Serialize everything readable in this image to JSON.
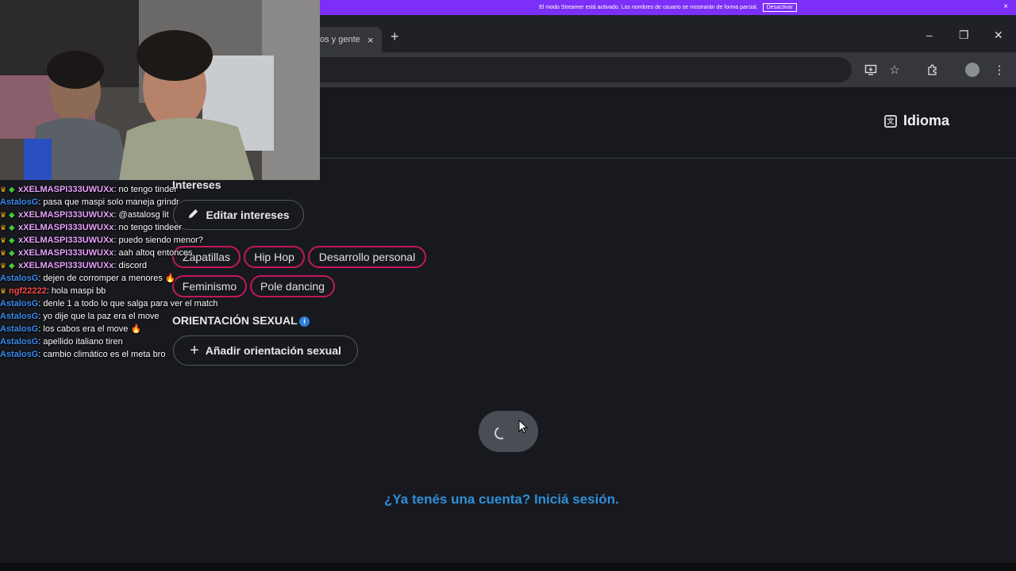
{
  "streamer_banner": {
    "text": "El modo Streamer está activado. Los nombres de usuario se mostrarán de forma parcial.",
    "button_label": "Desactivar",
    "close_icon": "×"
  },
  "browser": {
    "tab_title": "os y gente",
    "tab_close": "×",
    "new_tab": "+",
    "window_controls": {
      "minimize": "–",
      "restore": "❐",
      "close": "✕"
    },
    "toolbar_icons": [
      "install-app-icon",
      "bookmark-star-icon",
      "extensions-icon",
      "profile-avatar-icon",
      "menu-kebab-icon"
    ]
  },
  "header": {
    "language_label": "Idioma"
  },
  "interests": {
    "section_label": "Intereses",
    "edit_button_label": "Editar intereses",
    "chips": [
      "Zapatillas",
      "Hip Hop",
      "Desarrollo personal",
      "Feminismo",
      "Pole dancing"
    ]
  },
  "orientation": {
    "section_label": "ORIENTACIÓN SEXUAL",
    "add_button_label": "Añadir orientación sexual"
  },
  "login": {
    "link_text": "¿Ya tenés una cuenta? Iniciá sesión."
  },
  "chat": {
    "messages": [
      {
        "badges": [
          "crown",
          "gem"
        ],
        "user": "xXELMASPI333UWUXx",
        "user_color": "#e9a0ff",
        "text": ": no tengo tinder"
      },
      {
        "badges": [],
        "user": "AstalosG",
        "user_color": "#3a8cf0",
        "text": ": pasa que maspi solo maneja grindr"
      },
      {
        "badges": [
          "crown",
          "gem"
        ],
        "user": "xXELMASPI333UWUXx",
        "user_color": "#e9a0ff",
        "text": ": @astalosg lit"
      },
      {
        "badges": [
          "crown",
          "gem"
        ],
        "user": "xXELMASPI333UWUXx",
        "user_color": "#e9a0ff",
        "text": ": no tengo tindeer"
      },
      {
        "badges": [
          "crown",
          "gem"
        ],
        "user": "xXELMASPI333UWUXx",
        "user_color": "#e9a0ff",
        "text": ": puedo siendo menor?"
      },
      {
        "badges": [
          "crown",
          "gem"
        ],
        "user": "xXELMASPI333UWUXx",
        "user_color": "#e9a0ff",
        "text": ": aah altoq entonces"
      },
      {
        "badges": [
          "crown",
          "gem"
        ],
        "user": "xXELMASPI333UWUXx",
        "user_color": "#e9a0ff",
        "text": ": discord"
      },
      {
        "badges": [],
        "user": "AstalosG",
        "user_color": "#3a8cf0",
        "text": ": dejen de corromper a menores 🔥"
      },
      {
        "badges": [
          "crown"
        ],
        "user": "ngf22222",
        "user_color": "#ff4a4a",
        "text": ": hola maspi bb"
      },
      {
        "badges": [],
        "user": "AstalosG",
        "user_color": "#3a8cf0",
        "text": ": denle 1 a todo lo que salga para ver el match"
      },
      {
        "badges": [],
        "user": "AstalosG",
        "user_color": "#3a8cf0",
        "text": ": yo dije que la paz era el move"
      },
      {
        "badges": [],
        "user": "AstalosG",
        "user_color": "#3a8cf0",
        "text": ": los cabos era el move 🔥"
      },
      {
        "badges": [],
        "user": "AstalosG",
        "user_color": "#3a8cf0",
        "text": ": apellido italiano tiren"
      },
      {
        "badges": [],
        "user": "AstalosG",
        "user_color": "#3a8cf0",
        "text": ": cambio climático es el meta bro"
      }
    ]
  },
  "colors": {
    "streamer_banner": "#7b2ff7",
    "chip_border": "#c2185b",
    "link": "#2f8fd8",
    "page_bg": "#17191e"
  }
}
